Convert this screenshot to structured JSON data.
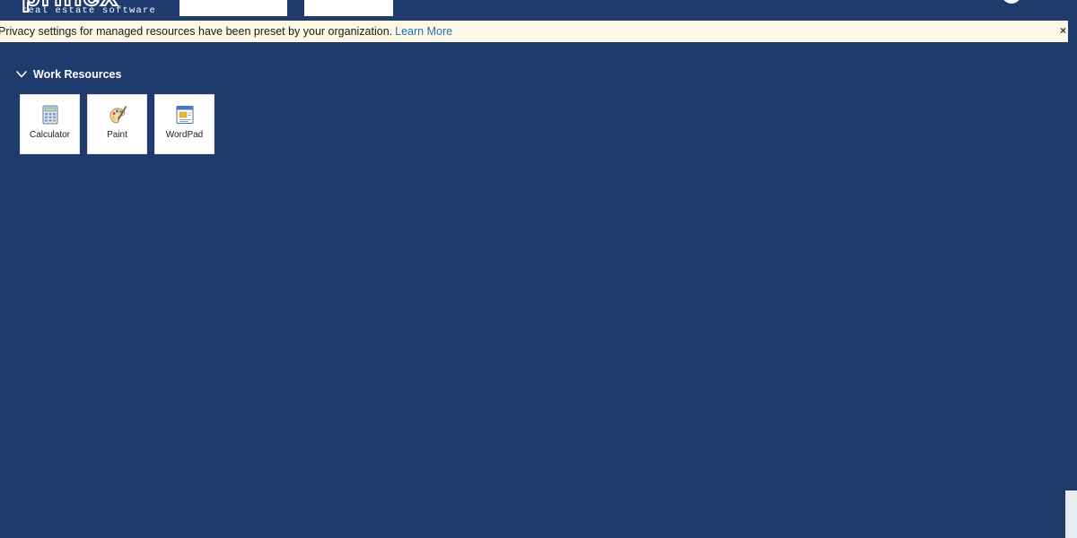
{
  "header": {
    "logo_wordmark": "prinex",
    "logo_tagline": "real estate software"
  },
  "notice": {
    "text": "Privacy settings for managed resources have been preset by your organization.",
    "link_label": "Learn More",
    "close_label": "×"
  },
  "section": {
    "title": "Work Resources",
    "expanded": true
  },
  "resources": [
    {
      "label": "Calculator",
      "icon": "calculator-icon"
    },
    {
      "label": "Paint",
      "icon": "paint-palette-icon"
    },
    {
      "label": "WordPad",
      "icon": "wordpad-icon"
    }
  ],
  "colors": {
    "background": "#1f3a6d",
    "notice_background": "#fcf8e3",
    "link": "#1a73b8",
    "tile_background": "#ffffff"
  }
}
